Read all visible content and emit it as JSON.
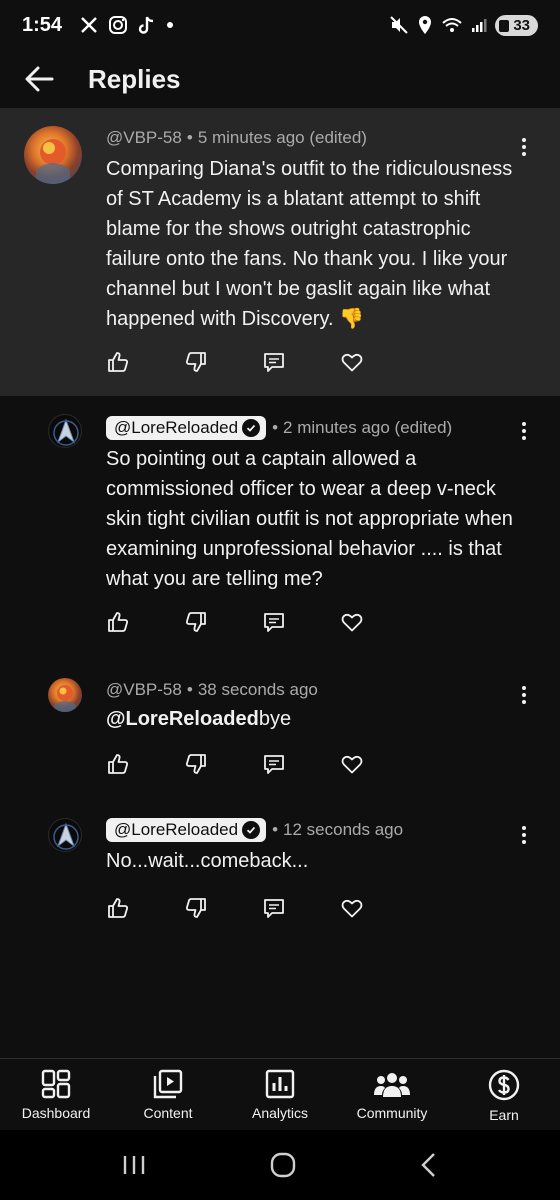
{
  "status_bar": {
    "time": "1:54",
    "battery": "33"
  },
  "header": {
    "title": "Replies"
  },
  "comments": [
    {
      "author": "@VBP-58",
      "time": "5 minutes ago (edited)",
      "text": "Comparing Diana's outfit to the ridiculousness of ST Academy is a blatant attempt to shift blame for the shows outright catastrophic failure onto the fans. No thank you. I like your channel but I won't be gaslit again like what happened with Discovery. 👎"
    },
    {
      "author": "@LoreReloaded",
      "time": "2 minutes ago (edited)",
      "text": "So pointing out a captain allowed a commissioned officer to wear a deep v-neck skin tight civilian outfit is not appropriate when examining unprofessional behavior .... is that what you are telling me?"
    },
    {
      "author": "@VBP-58",
      "time": "38 seconds ago",
      "mention": "@LoreReloaded",
      "text": "bye"
    },
    {
      "author": "@LoreReloaded",
      "time": "12 seconds ago",
      "text": "No...wait...comeback..."
    }
  ],
  "separator": "•",
  "bottom_nav": [
    {
      "label": "Dashboard",
      "icon": "dashboard-icon"
    },
    {
      "label": "Content",
      "icon": "content-icon"
    },
    {
      "label": "Analytics",
      "icon": "analytics-icon"
    },
    {
      "label": "Community",
      "icon": "community-icon"
    },
    {
      "label": "Earn",
      "icon": "earn-icon"
    }
  ],
  "colors": {
    "background": "#0f0f0f",
    "highlight": "#272727",
    "meta_text": "#aaaaaa"
  }
}
